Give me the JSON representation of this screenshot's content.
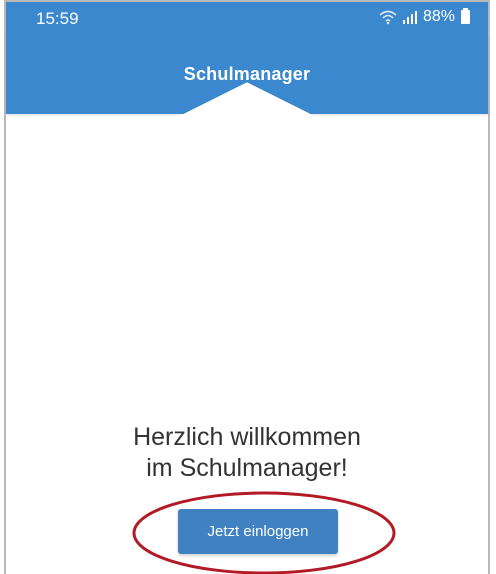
{
  "status_bar": {
    "time": "15:59",
    "battery_percent": "88%",
    "icons": [
      "wifi-icon",
      "signal-icon",
      "battery-icon"
    ]
  },
  "app": {
    "brand_name": "Schulmanager",
    "brand_icon": "graduation-cap-icon",
    "accent_color": "#3b88cf"
  },
  "welcome": {
    "line1": "Herzlich willkommen",
    "line2": "im Schulmanager!"
  },
  "login_button": {
    "label": "Jetzt einloggen",
    "color": "#3f81c1"
  },
  "annotation": {
    "highlight_color": "#b21b25",
    "shape": "ellipse"
  }
}
